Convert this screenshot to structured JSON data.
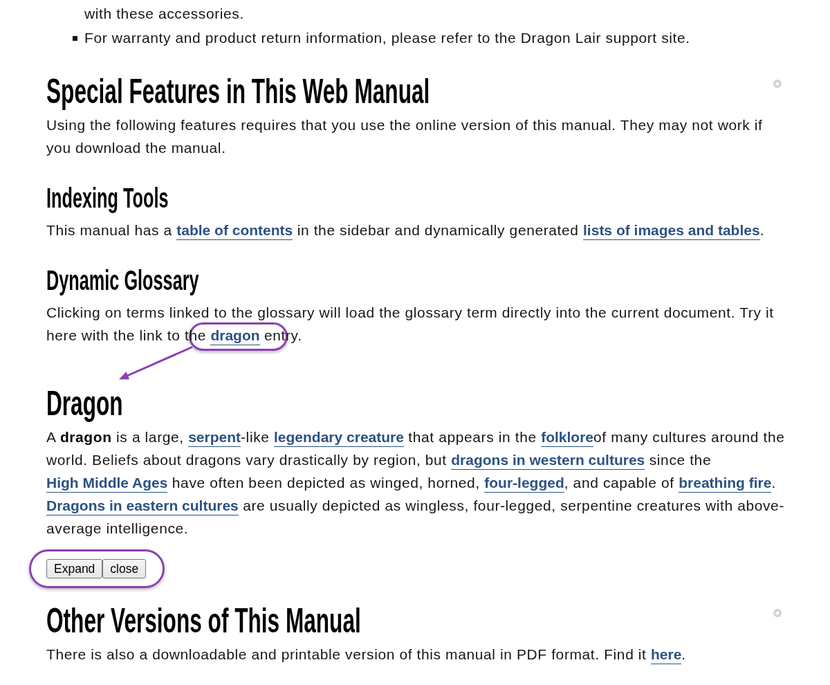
{
  "list": [
    {
      "kind": "continuation",
      "text": "with these accessories."
    },
    {
      "kind": "bullet",
      "text": "For warranty and product return information, please refer to the Dragon Lair support site."
    }
  ],
  "sections": [
    {
      "kind": "main",
      "heading": "Special Features in This Web Manual",
      "paragraph": [
        {
          "kind": "text",
          "text": "Using the following features requires that you use the online version of this manual. They may not work if you download the manual."
        }
      ]
    },
    {
      "kind": "sub",
      "heading": "Indexing Tools",
      "paragraph": [
        {
          "kind": "text",
          "text": "This manual has a "
        },
        {
          "kind": "link",
          "text": "table of contents",
          "highlighted": false
        },
        {
          "kind": "text",
          "text": " in the sidebar and dynamically generated "
        },
        {
          "kind": "link",
          "text": "lists of images and tables",
          "highlighted": false
        },
        {
          "kind": "text",
          "text": "."
        }
      ]
    },
    {
      "kind": "sub",
      "heading": "Dynamic Glossary",
      "paragraph": [
        {
          "kind": "text",
          "text": "Clicking on terms linked to the glossary will load the glossary term directly into the current document. Try it here with the link to the "
        },
        {
          "kind": "link",
          "text": "dragon",
          "highlighted": true
        },
        {
          "kind": "text",
          "text": " entry."
        }
      ]
    },
    {
      "kind": "glossary_entry",
      "heading": "Dragon",
      "paragraph": [
        {
          "kind": "text",
          "text": "A "
        },
        {
          "kind": "term",
          "text": "dragon"
        },
        {
          "kind": "text",
          "text": " is a large, "
        },
        {
          "kind": "link",
          "text": "serpent",
          "highlighted": false
        },
        {
          "kind": "text",
          "text": "-like "
        },
        {
          "kind": "link",
          "text": "legendary creature",
          "highlighted": false
        },
        {
          "kind": "text",
          "text": " that appears in the "
        },
        {
          "kind": "link",
          "text": "folklore",
          "highlighted": false
        },
        {
          "kind": "text",
          "text": "of many cultures around the world. Beliefs about dragons vary drastically by region, but "
        },
        {
          "kind": "link",
          "text": "dragons in western cultures",
          "highlighted": false
        },
        {
          "kind": "text",
          "text": " since the "
        },
        {
          "kind": "link",
          "text": "High Middle Ages",
          "highlighted": false
        },
        {
          "kind": "text",
          "text": " have often been depicted as winged, horned, "
        },
        {
          "kind": "link",
          "text": "four-legged",
          "highlighted": false
        },
        {
          "kind": "text",
          "text": ", and capable of "
        },
        {
          "kind": "link",
          "text": "breathing fire",
          "highlighted": false
        },
        {
          "kind": "text",
          "text": ". "
        },
        {
          "kind": "link",
          "text": "Dragons in eastern cultures",
          "highlighted": false
        },
        {
          "kind": "text",
          "text": " are usually depicted as wingless, four-legged, serpentine creatures with above-average intelligence."
        }
      ],
      "buttons": [
        {
          "label": "Expand"
        },
        {
          "label": "close"
        }
      ],
      "buttons_highlighted": true
    },
    {
      "kind": "main",
      "heading": "Other Versions of This Manual",
      "paragraph": [
        {
          "kind": "text",
          "text": "There is also a downloadable and printable version of this manual in PDF format. Find it "
        },
        {
          "kind": "link",
          "text": "here",
          "highlighted": false
        },
        {
          "kind": "text",
          "text": "."
        }
      ]
    }
  ]
}
